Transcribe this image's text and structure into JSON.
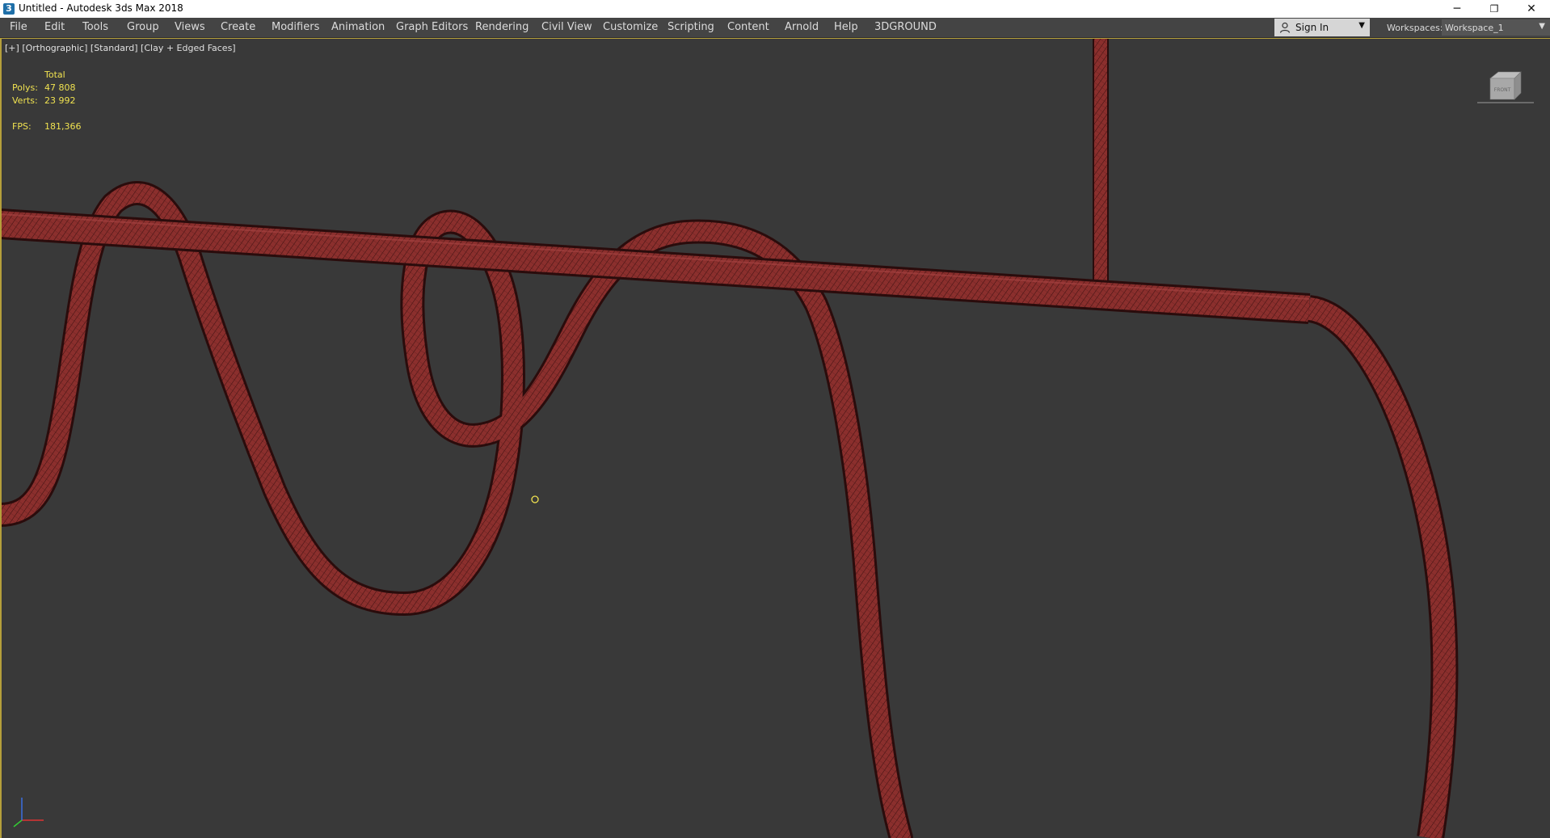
{
  "window": {
    "title": "Untitled - Autodesk 3ds Max 2018",
    "app_icon_glyph": "3",
    "controls": {
      "minimize": "─",
      "restore": "❐",
      "close": "✕"
    }
  },
  "menu": [
    "File",
    "Edit",
    "Tools",
    "Group",
    "Views",
    "Create",
    "Modifiers",
    "Animation",
    "Graph Editors",
    "Rendering",
    "Civil View",
    "Customize",
    "Scripting",
    "Content",
    "Arnold",
    "Help",
    "3DGROUND"
  ],
  "account": {
    "sign_in_label": "Sign In",
    "icon": "user-icon"
  },
  "workspaces": {
    "label": "Workspaces:",
    "value": "Workspace_1"
  },
  "viewport": {
    "label_plus": "[+]",
    "label_view": "[Orthographic]",
    "label_shading_style": "[Standard]",
    "label_shading_mode": "[Clay + Edged Faces]",
    "stats": {
      "header": "Total",
      "polys_label": "Polys:",
      "polys": "47 808",
      "verts_label": "Verts:",
      "verts": "23 992",
      "fps_label": "FPS:",
      "fps": "181,366"
    },
    "viewcube_face_label": "FRONT",
    "colors": {
      "stats_text": "#f0e250",
      "active_border": "#b59f3b",
      "tube_fill": "#8b2f2d",
      "tube_wire": "#3a1010",
      "background": "#393939"
    }
  }
}
